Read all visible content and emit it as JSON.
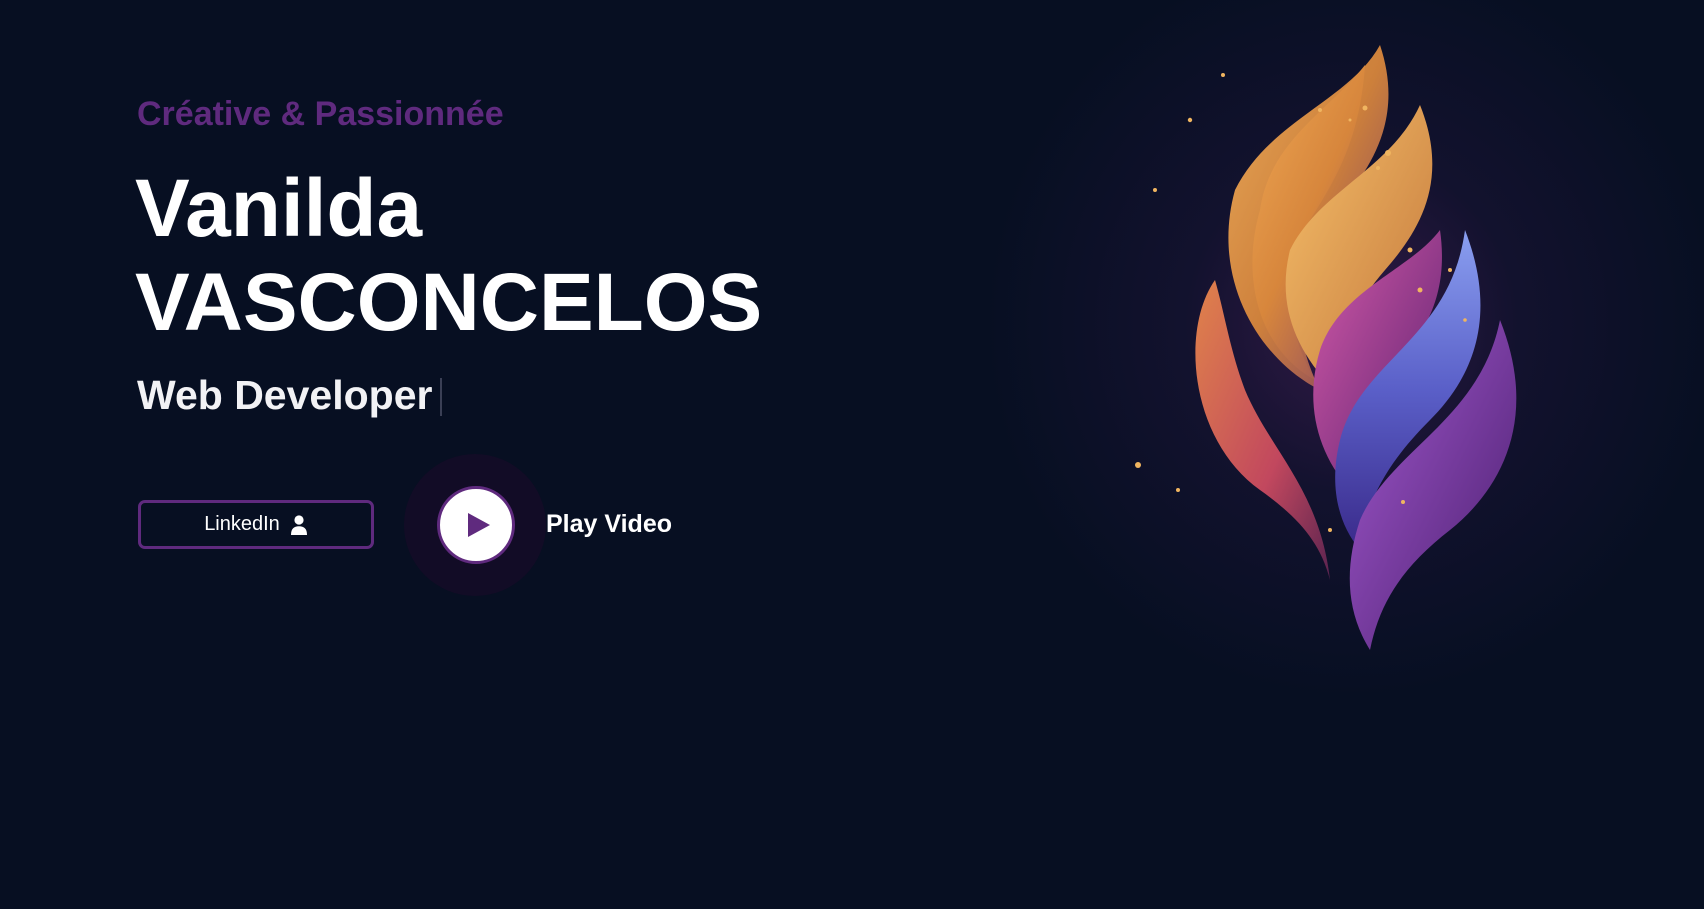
{
  "hero": {
    "tagline": "Créative & Passionnée",
    "first_name": "Vanilda",
    "last_name": "VASCONCELOS",
    "role": "Web Developer"
  },
  "actions": {
    "linkedin_label": "LinkedIn",
    "linkedin_icon": "user-icon",
    "play_label": "Play Video",
    "play_icon": "play-icon"
  },
  "colors": {
    "background": "#070f22",
    "accent": "#5f2a7e",
    "text": "#ffffff"
  },
  "hero_art": {
    "description_icon": "flame-illustration"
  }
}
